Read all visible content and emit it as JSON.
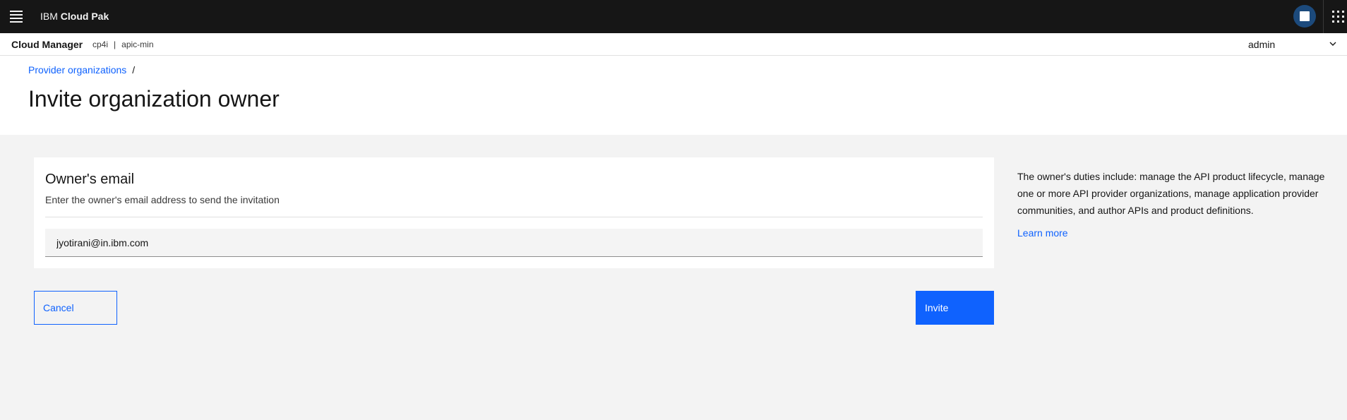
{
  "shell": {
    "brand_prefix": "IBM ",
    "brand_name": "Cloud Pak",
    "menu_icon": "hamburger-menu-icon",
    "avatar_icon": "user-avatar-icon",
    "app_switcher_icon": "app-switcher-grid-icon"
  },
  "subbar": {
    "product": "Cloud Manager",
    "context_1": "cp4i",
    "separator": "|",
    "context_2": "apic-min",
    "user": "admin",
    "user_chevron_icon": "chevron-down-icon"
  },
  "header": {
    "breadcrumb_link": "Provider organizations",
    "breadcrumb_sep": "/",
    "title": "Invite organization owner"
  },
  "form": {
    "section_title": "Owner's email",
    "section_subtitle": "Enter the owner's email address to send the invitation",
    "email_value": "jyotirani@in.ibm.com"
  },
  "help": {
    "text": "The owner's duties include: manage the API product lifecycle, manage one or more API provider organizations, manage application provider communities, and author APIs and product definitions.",
    "learn_more": "Learn more"
  },
  "actions": {
    "cancel": "Cancel",
    "invite": "Invite"
  },
  "colors": {
    "shell_bg": "#161616",
    "accent": "#0f62fe",
    "page_bg": "#f3f3f3"
  }
}
